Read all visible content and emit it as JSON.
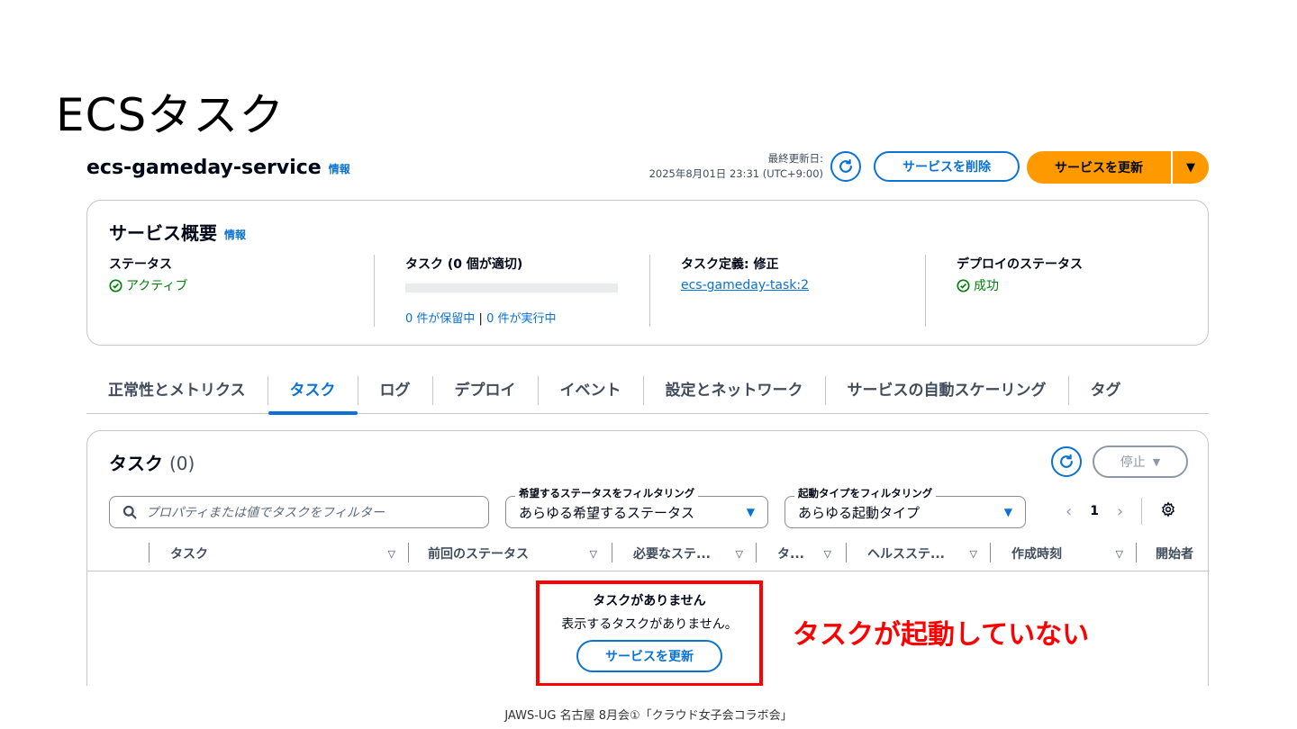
{
  "slide": {
    "title": "ECSタスク",
    "callout": "タスクが起動していない",
    "footer": "JAWS-UG 名古屋 8月会①「クラウド女子会コラボ会」"
  },
  "header": {
    "service_name": "ecs-gameday-service",
    "info": "情報",
    "last_updated_label": "最終更新日:",
    "last_updated_value": "2025年8月01日 23:31 (UTC+9:00)",
    "delete_label": "サービスを削除",
    "update_label": "サービスを更新"
  },
  "overview": {
    "title": "サービス概要",
    "info": "情報",
    "status_label": "ステータス",
    "status_value": "アクティブ",
    "tasks_label": "タスク (0 個が適切)",
    "pending": "0 件が保留中",
    "divider": "|",
    "running": "0 件が実行中",
    "taskdef_label": "タスク定義: 修正",
    "taskdef_value": "ecs-gameday-task:2",
    "deploy_label": "デプロイのステータス",
    "deploy_value": "成功"
  },
  "tabs": [
    "正常性とメトリクス",
    "タスク",
    "ログ",
    "デプロイ",
    "イベント",
    "設定とネットワーク",
    "サービスの自動スケーリング",
    "タグ"
  ],
  "tasks_panel": {
    "title": "タスク",
    "count": "(0)",
    "stop_label": "停止",
    "search_placeholder": "プロパティまたは値でタスクをフィルター",
    "filter1_caption": "希望するステータスをフィルタリング",
    "filter1_value": "あらゆる希望するステータス",
    "filter2_caption": "起動タイプをフィルタリング",
    "filter2_value": "あらゆる起動タイプ",
    "page": "1",
    "columns": [
      "タスク",
      "前回のステータス",
      "必要なステ...",
      "タ...",
      "ヘルスステ...",
      "作成時刻",
      "開始者"
    ],
    "empty_title": "タスクがありません",
    "empty_desc": "表示するタスクがありません。",
    "empty_button": "サービスを更新"
  },
  "colors": {
    "accent": "#0972d3",
    "primary": "#ff9900",
    "success": "#037f0c",
    "highlight": "#ff0000"
  }
}
